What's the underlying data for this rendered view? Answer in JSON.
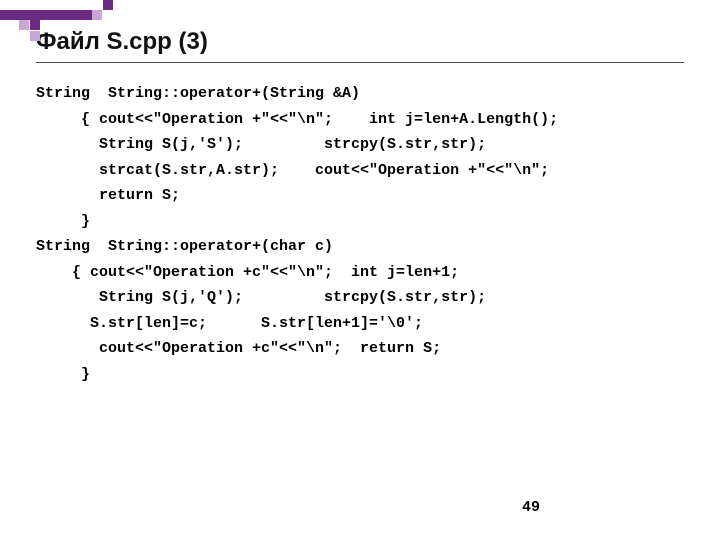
{
  "decor_color_dark": "#6a2c82",
  "decor_color_light": "#c9a7d6",
  "title": "Файл S.cpp (3)",
  "code_lines": [
    "String  String::operator+(String &A)",
    "     { cout<<\"Operation +\"<<\"\\n\";    int j=len+A.Length();",
    "       String S(j,'S');         strcpy(S.str,str);",
    "       strcat(S.str,A.str);    cout<<\"Operation +\"<<\"\\n\";",
    "       return S;",
    "     }",
    "String  String::operator+(char c)",
    "    { cout<<\"Operation +c\"<<\"\\n\";  int j=len+1;",
    "       String S(j,'Q');         strcpy(S.str,str);",
    "      S.str[len]=c;      S.str[len+1]='\\0';",
    "       cout<<\"Operation +c\"<<\"\\n\";  return S;",
    "     }"
  ],
  "page_number": "49"
}
